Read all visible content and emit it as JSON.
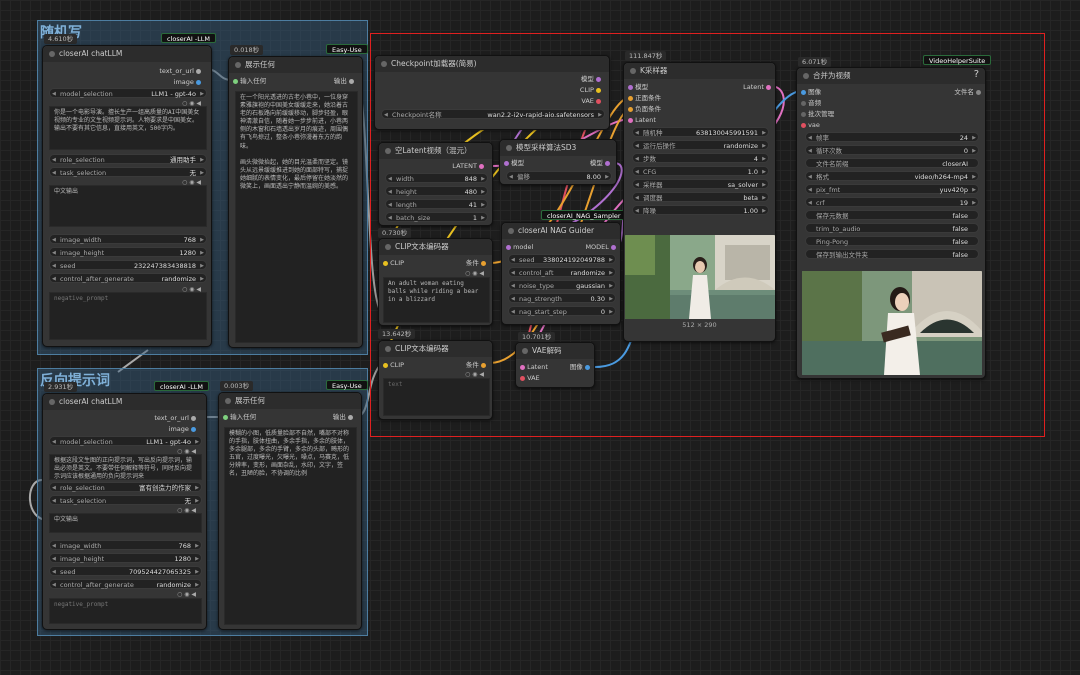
{
  "groups": {
    "g1": {
      "title": "随机写",
      "timer": "4.610秒"
    },
    "g2": {
      "title": "反向提示词",
      "timer": "2.931秒"
    }
  },
  "llm1": {
    "title": "closerAI chatLLM",
    "badge": "closerAI -LLM",
    "out1": "text_or_url",
    "out2": "image",
    "model_label": "model_selection",
    "model_value": "LLM1 - gpt-4o",
    "prompt": "你是一个电影导演。擅长生产一组高质量的AI中国美女视频的专业的文生视频提示词。人物要求是中国美女。输出不要有其它信息，直接用英文，500字内。",
    "role_label": "role_selection",
    "role_value": "通用助手",
    "task_label": "task_selection",
    "task_value": "无",
    "output": "中文输出",
    "iw_label": "image_width",
    "iw_value": "768",
    "ih_label": "image_height",
    "ih_value": "1280",
    "seed_label": "seed",
    "seed_value": "232247383438818",
    "cag_label": "control_after_generate",
    "cag_value": "randomize",
    "neg": "negative_prompt"
  },
  "show1": {
    "timer": "0.018秒",
    "title": "展示任何",
    "badge": "Easy-Use",
    "in": "输入任何",
    "out": "输出",
    "text": "在一个阳光透进的古老小巷中，一位身穿素雅旗袍的中国美女缓缓走来，她沿着古老的石板路向前缓缓移动，脚步轻盈，眼神清澈自信，随着她一步步前进，小巷两侧的木窗和石墙透出岁月的痕迹，周围偶有飞鸟掠过，整条小巷弥漫着东方的韵味。\n\n画头微微抬起，她的目光温柔而坚定。镜头从远景缓缓推进到她的面部特写，捕捉她细腻的表情变化，最后停留在她淡然的微笑上，画面透出宁静而温婉的美感。"
  },
  "ckpt": {
    "title": "Checkpoint加载器(简易)",
    "o1": "模型",
    "o2": "CLIP",
    "o3": "VAE",
    "w_label": "Checkpoint名称",
    "w_value": "wan2.2-i2v-rapid-aio.safetensors"
  },
  "latent": {
    "timer": "0.730秒",
    "title": "空Latent视频（混元）",
    "out": "LATENT",
    "w_label": "width",
    "w_value": "848",
    "h_label": "height",
    "h_value": "480",
    "l_label": "length",
    "l_value": "41",
    "b_label": "batch_size",
    "b_value": "1"
  },
  "sd3": {
    "title": "模型采样算法SD3",
    "in": "模型",
    "out": "模型",
    "s_label": "偏移",
    "s_value": "8.00"
  },
  "clip1": {
    "title": "CLIP文本编码器",
    "in": "CLIP",
    "out": "条件",
    "text": "An adult woman eating balls while riding a bear in a blizzard"
  },
  "clip2": {
    "timer": "13.642秒",
    "title": "CLIP文本编码器",
    "in": "CLIP",
    "out": "条件",
    "text": "text"
  },
  "nag": {
    "badge": "closerAI_NAG_Sampler",
    "title": "closerAI NAG Guider",
    "in": "model",
    "out": "MODEL",
    "seed_label": "seed",
    "seed_value": "338024192049788",
    "ca_label": "control_aft",
    "ca_value": "randomize",
    "nt_label": "noise_type",
    "nt_value": "gaussian",
    "ns_label": "nag_strength",
    "ns_value": "0.30",
    "nst_label": "nag_start_step",
    "nst_value": "0"
  },
  "vae": {
    "timer": "10.701秒",
    "title": "VAE解码",
    "in1": "Latent",
    "in2": "VAE",
    "out": "图像"
  },
  "ks": {
    "timer": "111.847秒",
    "title": "K采样器",
    "i1": "模型",
    "i2": "正面条件",
    "i3": "负面条件",
    "i4": "Latent",
    "out": "Latent",
    "seed_label": "随机种",
    "seed_value": "638130045991591",
    "run_label": "运行后操作",
    "run_value": "randomize",
    "steps_label": "步数",
    "steps_value": "4",
    "cfg_label": "CFG",
    "cfg_value": "1.0",
    "sampler_label": "采样器",
    "sampler_value": "sa_solver",
    "sched_label": "调度器",
    "sched_value": "beta",
    "denoise_label": "降噪",
    "denoise_value": "1.00",
    "size": "512 × 290"
  },
  "vhs": {
    "timer": "6.071秒",
    "badge": "VideoHelperSuite",
    "title": "合并为视频",
    "i1": "图像",
    "i2": "音频",
    "i3": "批次管理",
    "i4": "vae",
    "out": "文件名",
    "fr_label": "帧率",
    "fr_value": "24",
    "loop_label": "循环次数",
    "loop_value": "0",
    "prefix_label": "文件名前缀",
    "prefix_value": "closerAI",
    "fmt_label": "格式",
    "fmt_value": "video/h264-mp4",
    "pix_label": "pix_fmt",
    "pix_value": "yuv420p",
    "crf_label": "crf",
    "crf_value": "19",
    "save_label": "保存元数据",
    "save_value": "false",
    "trim_label": "trim_to_audio",
    "trim_value": "false",
    "pp_label": "Ping-Pong",
    "pp_value": "false",
    "so_label": "保存到输出文件夹",
    "so_value": "false",
    "help": "?"
  },
  "llm2": {
    "title": "closerAI chatLLM",
    "badge": "closerAI -LLM",
    "out1": "text_or_url",
    "out2": "image",
    "model_label": "model_selection",
    "model_value": "LLM1 - gpt-4o",
    "prompt": "根据这段文生图的正向提示词，写出反向提示词，输出必须是英文。不要带任何解释等符号，同时反向提示词应该根据通用的负向提示词来",
    "role_label": "role_selection",
    "role_value": "富有创造力的作家",
    "task_label": "task_selection",
    "task_value": "无",
    "output": "中文输出",
    "iw_label": "image_width",
    "iw_value": "768",
    "ih_label": "image_height",
    "ih_value": "1280",
    "seed_label": "seed",
    "seed_value": "709524427065325",
    "cag_label": "control_after_generate",
    "cag_value": "randomize",
    "neg": "negative_prompt"
  },
  "show2": {
    "timer": "0.003秒",
    "title": "展示任何",
    "badge": "Easy-Use",
    "in": "输入任何",
    "out": "输出",
    "text": "模糊的小图，低质量脸部不自然，嘴部不对称的手指，肢体扭曲，多余手指，多余的肢体，多余腿部，多余的手臂，多余的头部，畸形的五官，过度曝光，欠曝光，噪点，马赛克，低分辨率，变形，画面杂乱，水印，文字，签名，丑陋的脸，不协调的比例"
  }
}
